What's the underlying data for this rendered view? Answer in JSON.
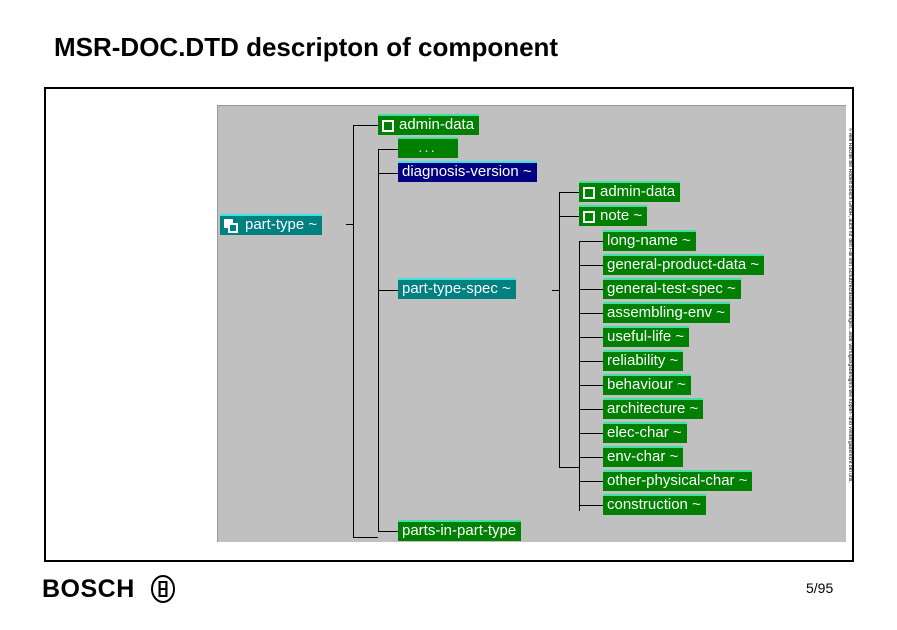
{
  "slide": {
    "title": "MSR-DOC.DTD descripton of component",
    "page_number": "5/95",
    "brand": "BOSCH",
    "brand_mark_icon": "bosch-anchor-logo-icon",
    "copyright_vertical": "© Alle Rechte bei Robert Bosch GmbH, auch für den Fall von Schutzrechtsanmeldungen. Jede Verfügungsbefugnis wie Kopier- und Weitergaberecht bei uns."
  },
  "colors": {
    "canvas": "#c0c0c0",
    "element_node": "#008000",
    "element_highlight": "#40e0a0",
    "complex_node": "#008080",
    "complex_highlight": "#40e0e0",
    "selected_node": "#000080",
    "connector": "#000000",
    "text": "#ffffff"
  },
  "tree": {
    "root": {
      "label": "part-type ~",
      "icon": "stacked-squares-icon",
      "style": "teal"
    },
    "level1": [
      {
        "label": "admin-data",
        "icon": "square-icon",
        "style": "green"
      },
      {
        "label": "...",
        "icon": "none",
        "style": "ellipsis"
      },
      {
        "label": "diagnosis-version ~",
        "icon": "none",
        "style": "navy"
      },
      {
        "label": "part-type-spec ~",
        "icon": "none",
        "style": "teal"
      },
      {
        "label": "parts-in-part-type",
        "icon": "none",
        "style": "green"
      }
    ],
    "spec_children": [
      {
        "label": "admin-data",
        "icon": "square-icon",
        "style": "green"
      },
      {
        "label": "note ~",
        "icon": "square-icon",
        "style": "green"
      }
    ],
    "spec_leaf_children": [
      {
        "label": "long-name ~"
      },
      {
        "label": "general-product-data ~"
      },
      {
        "label": "general-test-spec ~"
      },
      {
        "label": "assembling-env ~"
      },
      {
        "label": "useful-life ~"
      },
      {
        "label": "reliability ~"
      },
      {
        "label": "behaviour ~"
      },
      {
        "label": "architecture ~"
      },
      {
        "label": "elec-char ~"
      },
      {
        "label": "env-char ~"
      },
      {
        "label": "other-physical-char ~"
      },
      {
        "label": "construction ~"
      }
    ]
  }
}
